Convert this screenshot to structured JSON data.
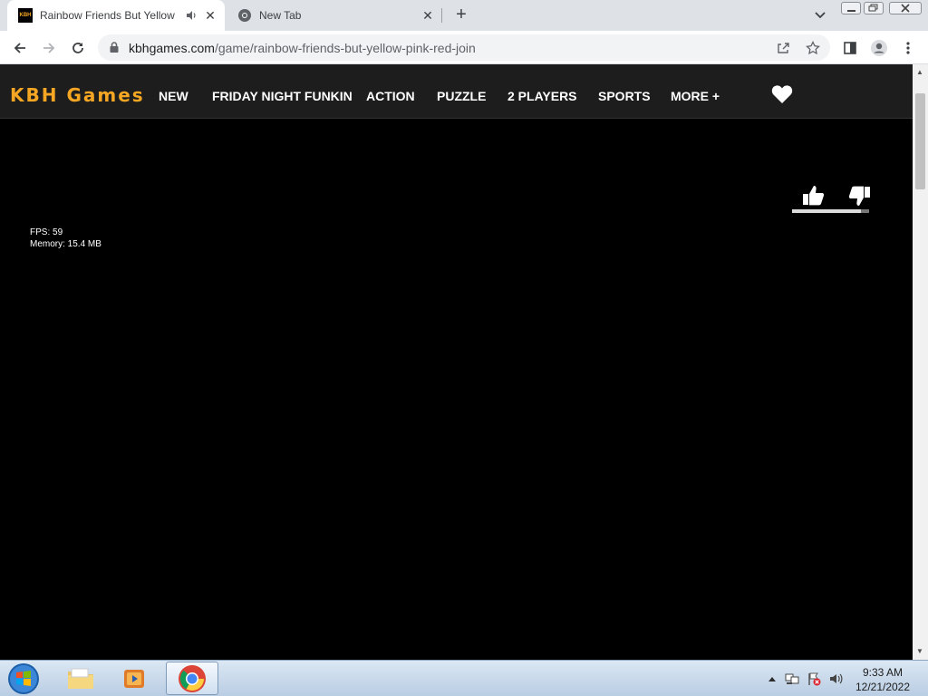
{
  "browser": {
    "tabs": [
      {
        "title": "Rainbow Friends But Yellow",
        "favicon": "KBH",
        "active": true
      },
      {
        "title": "New Tab",
        "active": false
      }
    ],
    "url_host": "kbhgames.com",
    "url_path": "/game/rainbow-friends-but-yellow-pink-red-join"
  },
  "site": {
    "logo": "KBH Games",
    "nav": [
      "NEW",
      "FRIDAY NIGHT FUNKIN",
      "ACTION",
      "PUZZLE",
      "2 PLAYERS",
      "SPORTS",
      "MORE +"
    ],
    "accent_color": "#f5a623"
  },
  "game": {
    "fps_label": "FPS: 59",
    "memory_label": "Memory: 15.4 MB",
    "vote_like_fraction": 0.89
  },
  "taskbar": {
    "time": "9:33 AM",
    "date": "12/21/2022"
  }
}
